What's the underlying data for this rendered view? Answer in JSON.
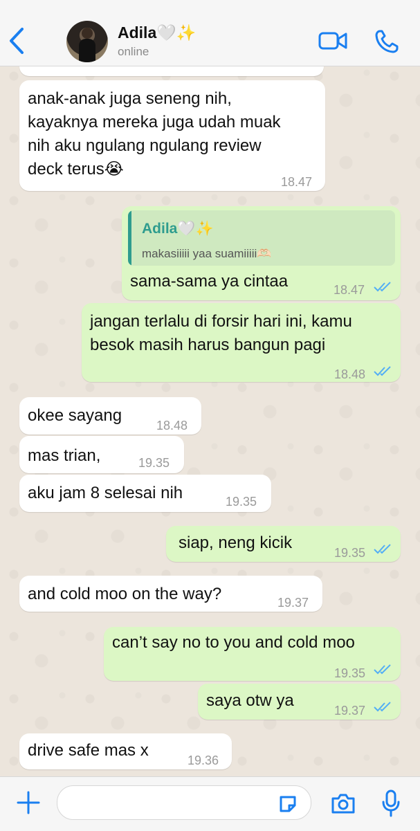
{
  "colors": {
    "accent": "#1a7ff0",
    "outgoing_bubble": "#dcf7c5",
    "incoming_bubble": "#ffffff",
    "read_ticks": "#53aef5",
    "quote_name": "#2e9c8e"
  },
  "header": {
    "contact_name": "Adila🤍✨",
    "status": "online",
    "icons": {
      "back": "chevron-left-icon",
      "video": "video-camera-icon",
      "call": "phone-icon"
    }
  },
  "messages": [
    {
      "direction": "in",
      "text": "anak-anak juga seneng nih,\nkayaknya mereka juga udah muak\nnih aku ngulang ngulang review\ndeck terus😭",
      "time": "18.47"
    },
    {
      "direction": "out",
      "quote_name": "Adila🤍✨",
      "quote_text": "makasiiiii yaa suamiiiii🫶🏻",
      "text": "sama-sama ya cintaa",
      "time": "18.47",
      "read": true
    },
    {
      "direction": "out",
      "text": "jangan terlalu di forsir hari ini, kamu\nbesok masih harus bangun pagi",
      "time": "18.48",
      "read": true
    },
    {
      "direction": "in",
      "text": "okee sayang",
      "time": "18.48"
    },
    {
      "direction": "in",
      "text": "mas trian,",
      "time": "19.35"
    },
    {
      "direction": "in",
      "text": "aku jam 8 selesai nih",
      "time": "19.35"
    },
    {
      "direction": "out",
      "text": "siap, neng kicik",
      "time": "19.35",
      "read": true
    },
    {
      "direction": "in",
      "text": "and cold moo on the way?",
      "time": "19.37"
    },
    {
      "direction": "out",
      "text": "can’t say no to you and cold moo",
      "time": "19.35",
      "read": true
    },
    {
      "direction": "out",
      "text": "saya otw ya",
      "time": "19.37",
      "read": true
    },
    {
      "direction": "in",
      "text": "drive safe mas x",
      "time": "19.36"
    }
  ],
  "composer": {
    "input_value": "",
    "icons": {
      "add": "plus-icon",
      "sticker": "sticker-icon",
      "camera": "camera-icon",
      "mic": "microphone-icon"
    }
  }
}
